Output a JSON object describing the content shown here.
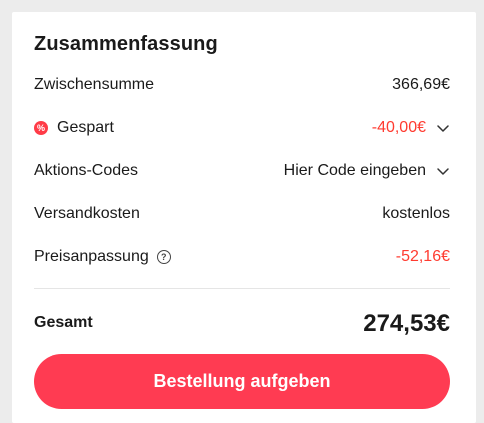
{
  "summary": {
    "title": "Zusammenfassung",
    "subtotal": {
      "label": "Zwischensumme",
      "value": "366,69€"
    },
    "saved": {
      "label": "Gespart",
      "value": "-40,00€",
      "badge": "%"
    },
    "promo": {
      "label": "Aktions-Codes",
      "value": "Hier Code eingeben"
    },
    "shipping": {
      "label": "Versandkosten",
      "value": "kostenlos"
    },
    "price_adjustment": {
      "label": "Preisanpassung",
      "value": "-52,16€",
      "help": "?"
    },
    "total": {
      "label": "Gesamt",
      "value": "274,53€"
    },
    "cta_label": "Bestellung aufgeben"
  },
  "colors": {
    "accent": "#ff3b52",
    "discount_text": "#ff3b30",
    "background": "#ececec",
    "card": "#ffffff"
  },
  "icons": {
    "saved": "percent-badge-icon",
    "expand": "chevron-down-icon",
    "help": "question-circle-icon"
  }
}
